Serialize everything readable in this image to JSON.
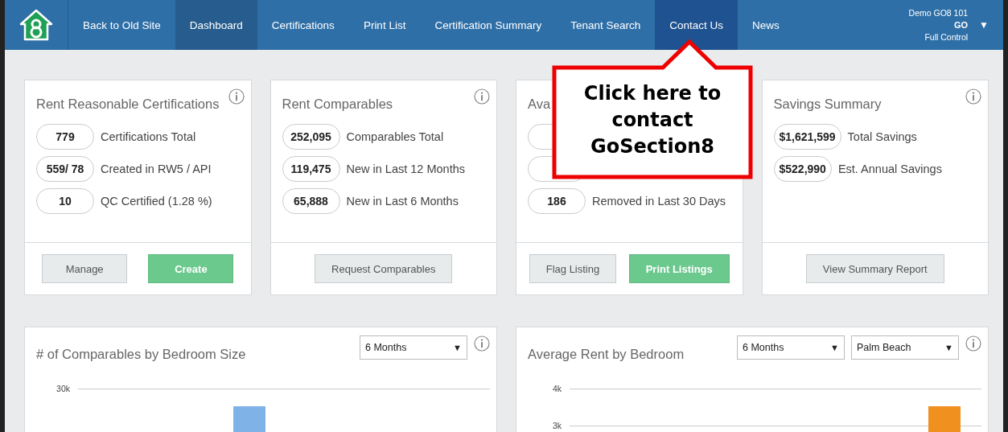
{
  "nav": {
    "items": [
      {
        "label": "Back to Old Site",
        "selected": false,
        "hovered": false
      },
      {
        "label": "Dashboard",
        "selected": true,
        "hovered": false
      },
      {
        "label": "Certifications",
        "selected": false,
        "hovered": false
      },
      {
        "label": "Print List",
        "selected": false,
        "hovered": false
      },
      {
        "label": "Certification Summary",
        "selected": false,
        "hovered": false
      },
      {
        "label": "Tenant Search",
        "selected": false,
        "hovered": false
      },
      {
        "label": "Contact Us",
        "selected": false,
        "hovered": true
      },
      {
        "label": "News",
        "selected": false,
        "hovered": false
      }
    ],
    "user": {
      "company": "Demo GO8 101",
      "name": "GO",
      "role": "Full Control",
      "caret": "▼"
    }
  },
  "cards": [
    {
      "title": "Rent Reasonable Certifications",
      "stats": [
        {
          "kind": "stat",
          "value": "779",
          "label": "Certifications Total"
        },
        {
          "kind": "stat",
          "value": "559/ 78",
          "label": "Created in RW5 / API"
        },
        {
          "kind": "stat",
          "value": "10",
          "label": "QC Certified (1.28 %)"
        }
      ],
      "buttons": [
        {
          "label": "Manage",
          "kind": "secondary"
        },
        {
          "label": "Create",
          "kind": "primary"
        }
      ]
    },
    {
      "title": "Rent Comparables",
      "stats": [
        {
          "kind": "stat",
          "value": "252,095",
          "label": "Comparables Total"
        },
        {
          "kind": "stat",
          "value": "119,475",
          "label": "New in Last 12 Months"
        },
        {
          "kind": "stat",
          "value": "65,888",
          "label": "New in Last 6 Months"
        }
      ],
      "buttons": [
        {
          "label": "Request Comparables",
          "kind": "secondary"
        }
      ]
    },
    {
      "title": "Ava",
      "stats": [
        {
          "kind": "covered"
        },
        {
          "kind": "covered"
        },
        {
          "kind": "stat",
          "value": "186",
          "label": "Removed in Last 30 Days"
        }
      ],
      "buttons": [
        {
          "label": "Flag Listing",
          "kind": "secondary"
        },
        {
          "label": "Print Listings",
          "kind": "primary"
        }
      ]
    },
    {
      "title": "Savings Summary",
      "stats": [
        {
          "kind": "stat",
          "value": "$1,621,599",
          "label": "Total Savings"
        },
        {
          "kind": "stat",
          "value": "$522,990",
          "label": "Est. Annual Savings"
        }
      ],
      "buttons": [
        {
          "label": "View Summary Report",
          "kind": "secondary"
        }
      ]
    }
  ],
  "charts": [
    {
      "title": "# of Comparables by Bedroom Size",
      "selects": [
        "6 Months"
      ],
      "select_caret": "▼",
      "axis_labels": [
        "30k"
      ]
    },
    {
      "title": "Average Rent by Bedroom",
      "selects": [
        "6 Months",
        "Palm Beach"
      ],
      "select_caret": "▼",
      "axis_labels": [
        "4k",
        "3k"
      ]
    }
  ],
  "callout": {
    "text": "Click here to contact GoSection8"
  }
}
